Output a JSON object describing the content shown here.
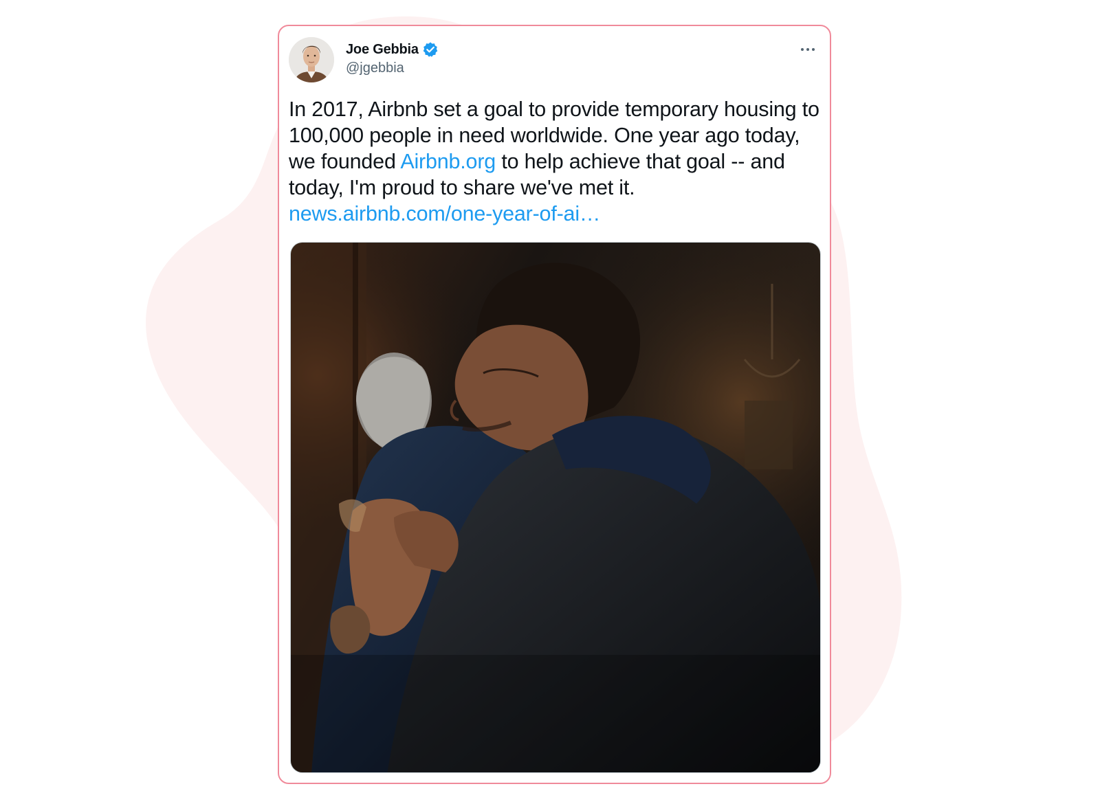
{
  "tweet": {
    "author_name": "Joe Gebbia",
    "author_handle": "@jgebbia",
    "text_part1": "In 2017, Airbnb set a goal to provide temporary housing to 100,000 people in need worldwide. One year ago today, we founded ",
    "inline_link": "Airbnb.org",
    "text_part2": " to help achieve that goal -- and today, I'm proud to share we've met it.",
    "url_link": "news.airbnb.com/one-year-of-ai…"
  },
  "icons": {
    "verified": "verified-badge-icon",
    "more": "more-options-icon"
  },
  "colors": {
    "card_border": "#f08a9a",
    "background_blob": "#fdf1f1",
    "link": "#1d9bf0",
    "verified": "#1d9bf0",
    "text_primary": "#0f1419",
    "text_secondary": "#536471"
  }
}
